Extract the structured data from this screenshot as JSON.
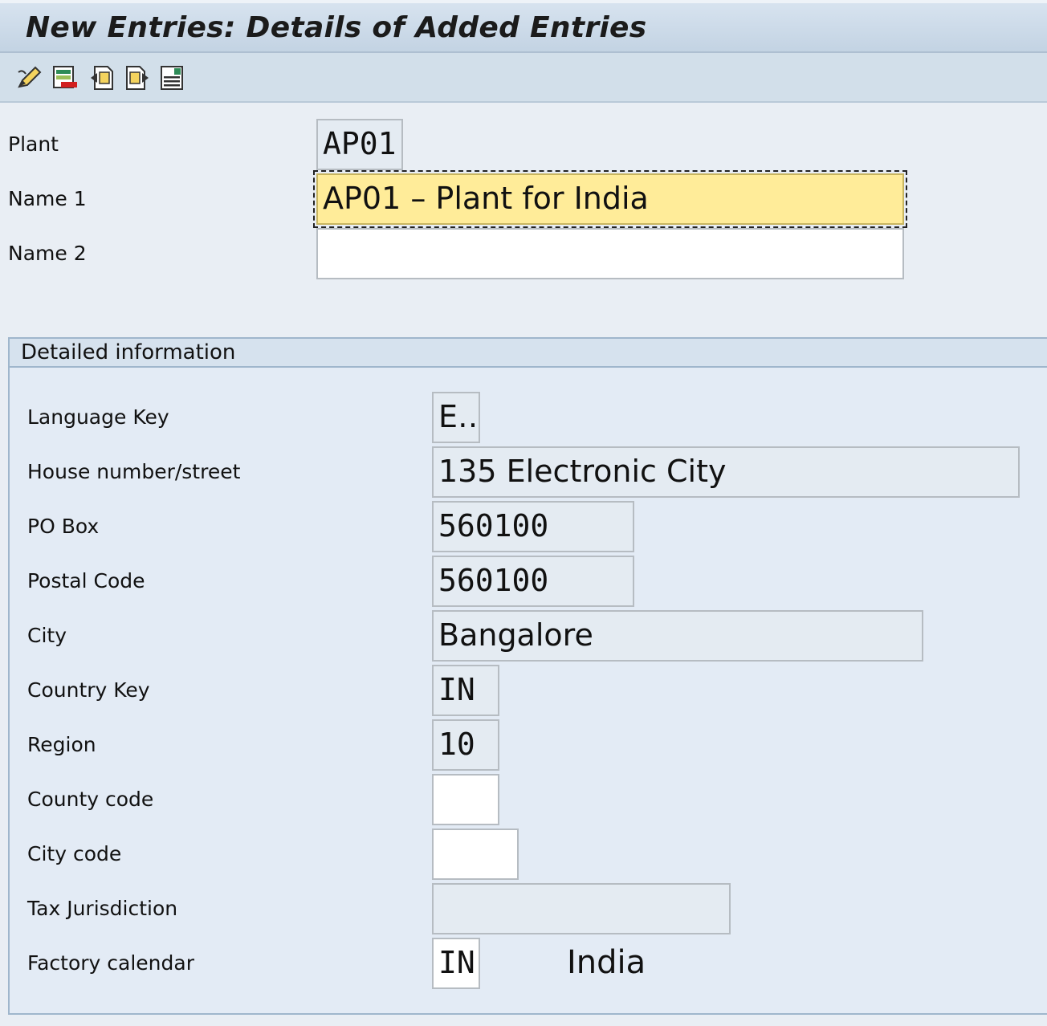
{
  "window": {
    "title": "New Entries: Details of Added Entries"
  },
  "toolbar": {
    "buttons": [
      {
        "icon": "edit-pencil-icon"
      },
      {
        "icon": "delete-entry-icon"
      },
      {
        "icon": "previous-entry-icon"
      },
      {
        "icon": "next-entry-icon"
      },
      {
        "icon": "details-list-icon"
      }
    ]
  },
  "header_fields": {
    "plant": {
      "label": "Plant",
      "value": "AP01"
    },
    "name1": {
      "label": "Name 1",
      "value": "AP01 – Plant for India"
    },
    "name2": {
      "label": "Name 2",
      "value": ""
    }
  },
  "detailed_information": {
    "title": "Detailed information",
    "language_key": {
      "label": "Language Key",
      "value": "E…"
    },
    "house_street": {
      "label": "House number/street",
      "value": "135 Electronic City"
    },
    "po_box": {
      "label": "PO Box",
      "value": "560100"
    },
    "postal_code": {
      "label": "Postal Code",
      "value": "560100"
    },
    "city": {
      "label": "City",
      "value": "Bangalore"
    },
    "country_key": {
      "label": "Country Key",
      "value": "IN"
    },
    "region": {
      "label": "Region",
      "value": "10"
    },
    "county_code": {
      "label": "County code",
      "value": ""
    },
    "city_code": {
      "label": "City code",
      "value": ""
    },
    "tax_jurisdiction": {
      "label": "Tax Jurisdiction",
      "value": ""
    },
    "factory_calendar": {
      "label": "Factory calendar",
      "value": "IN",
      "description": "India"
    }
  },
  "colors": {
    "title_bar": "#c3d3e3",
    "focused_field": "#ffec99",
    "input_field": "#e4ebf2",
    "group_border": "#9fb6cc"
  }
}
